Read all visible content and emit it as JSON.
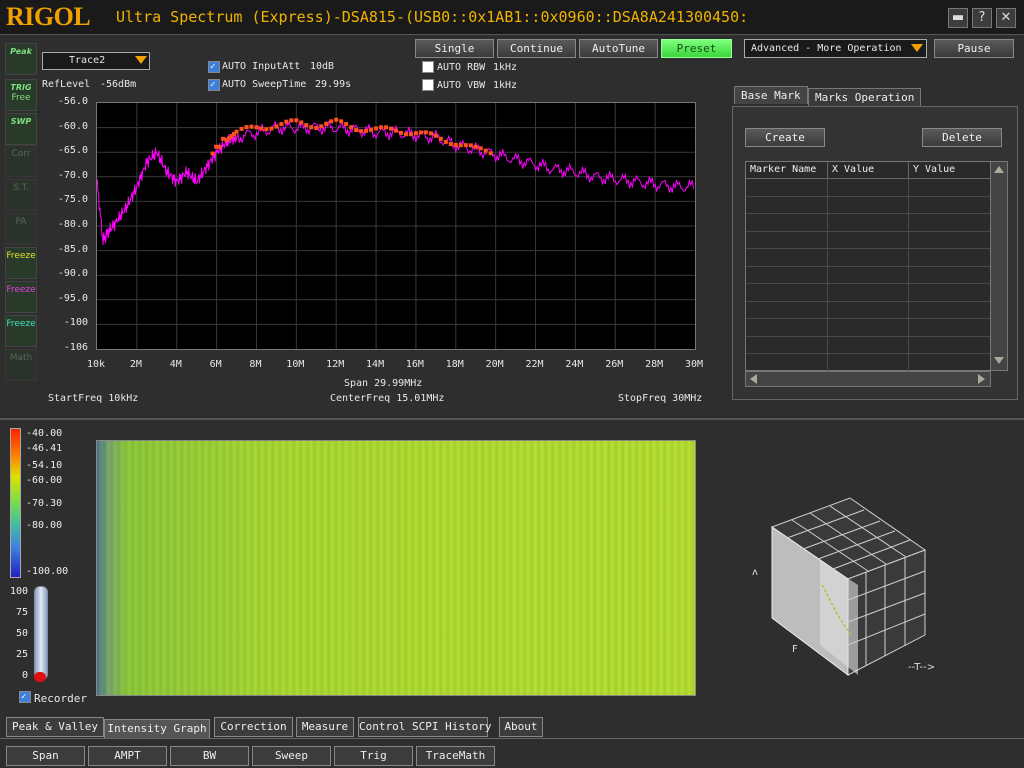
{
  "app": {
    "logo": "RIGOL",
    "title": "Ultra Spectrum (Express)-DSA815-(USB0::0x1AB1::0x0960::DSA8A241300450:",
    "window_controls": {
      "minimize": "▬",
      "help": "?",
      "close": "✕"
    }
  },
  "toolbar": {
    "single": "Single",
    "continue": "Continue",
    "autotune": "AutoTune",
    "preset": "Preset",
    "advanced": "Advanced - More Operation",
    "pause": "Pause"
  },
  "trace_select": "Trace2",
  "reflevel": {
    "label": "RefLevel",
    "value": "-56dBm"
  },
  "settings": {
    "auto_inputatt": {
      "label": "AUTO InputAtt",
      "value": "10dB",
      "checked": true
    },
    "auto_sweeptime": {
      "label": "AUTO SweepTime",
      "value": "29.99s",
      "checked": true
    },
    "auto_rbw": {
      "label": "AUTO RBW",
      "value": "1kHz",
      "checked": false
    },
    "auto_vbw": {
      "label": "AUTO VBW",
      "value": "1kHz",
      "checked": false
    }
  },
  "side_tools": [
    {
      "top": "Peak",
      "bottom": "",
      "icon": "peak-icon"
    },
    {
      "top": "TRIG",
      "bottom": "Free",
      "icon": "trig-icon"
    },
    {
      "top": "SWP",
      "bottom": "",
      "icon": "sweep-icon"
    },
    {
      "top": "",
      "bottom": "Corr",
      "icon": "corr-icon"
    },
    {
      "top": "",
      "bottom": "S.T.",
      "icon": "st-icon"
    },
    {
      "top": "",
      "bottom": "PA",
      "icon": "pa-icon"
    },
    {
      "top": "",
      "bottom": "Freeze",
      "icon": "freeze-yellow-icon"
    },
    {
      "top": "",
      "bottom": "Freeze",
      "icon": "freeze-magenta-icon"
    },
    {
      "top": "",
      "bottom": "Freeze",
      "icon": "freeze-cyan-icon"
    },
    {
      "top": "",
      "bottom": "Math",
      "icon": "math-icon"
    }
  ],
  "spectrum": {
    "span": "Span  29.99MHz",
    "start": "StartFreq  10kHz",
    "center": "CenterFreq  15.01MHz",
    "stop": "StopFreq  30MHz"
  },
  "chart_data": {
    "type": "line",
    "x_ticks": [
      "10k",
      "2M",
      "4M",
      "6M",
      "8M",
      "10M",
      "12M",
      "14M",
      "16M",
      "18M",
      "20M",
      "22M",
      "24M",
      "26M",
      "28M",
      "30M"
    ],
    "y_ticks": [
      "-56.0",
      "-60.0",
      "-65.0",
      "-70.0",
      "-75.0",
      "-80.0",
      "-85.0",
      "-90.0",
      "-95.0",
      "-100",
      "-106"
    ],
    "xlim": [
      0,
      30
    ],
    "ylim": [
      -106,
      -56
    ],
    "grid": true,
    "series": [
      {
        "color": "#ff00ff",
        "x": [
          0,
          0.3,
          0.6,
          1,
          1.5,
          2,
          2.5,
          3,
          3.5,
          4,
          4.5,
          5,
          5.5,
          6,
          6.5,
          7,
          8,
          9,
          10,
          11,
          12,
          13,
          14,
          15,
          16,
          17,
          18,
          19,
          20,
          21,
          22,
          23,
          24,
          25,
          26,
          27,
          28,
          29,
          30
        ],
        "y": [
          -72,
          -84,
          -82,
          -80,
          -77,
          -73,
          -68,
          -66,
          -70,
          -72,
          -70,
          -72,
          -69,
          -66,
          -64,
          -63,
          -62,
          -61,
          -61,
          -61,
          -61,
          -61.5,
          -62,
          -62,
          -62.5,
          -63,
          -64.5,
          -65.5,
          -66.5,
          -67.5,
          -68.5,
          -69.5,
          -70,
          -71,
          -71.5,
          -72,
          -72.5,
          -73,
          -73
        ]
      },
      {
        "color": "#ff5020",
        "x": [
          5.8,
          6.5,
          7,
          8,
          9,
          10,
          11,
          12,
          13,
          14,
          15,
          16,
          17,
          18,
          19,
          20
        ],
        "y": [
          -66,
          -63,
          -62,
          -61,
          -60.5,
          -60,
          -60.5,
          -60,
          -61,
          -61.5,
          -61.5,
          -62,
          -63,
          -64,
          -65.5,
          -66
        ]
      }
    ]
  },
  "marker_panel": {
    "tabs": [
      "Base Mark",
      "Marks Operation"
    ],
    "create": "Create",
    "delete": "Delete",
    "columns": [
      "Marker Name",
      "X Value",
      "Y Value"
    ]
  },
  "intensity": {
    "colorbar_labels": [
      "-40.00",
      "-46.41",
      "-54.10",
      "-60.00",
      "-70.30",
      "-80.00",
      "-100.00"
    ],
    "thermo_labels": [
      "100",
      "75",
      "50",
      "25",
      "0"
    ],
    "recorder": "Recorder",
    "recorder_checked": true
  },
  "bottom_tabs": [
    "Peak & Valley",
    "Intensity Graph",
    "Correction",
    "Measure",
    "Control SCPI History",
    "About"
  ],
  "bottom_buttons": [
    "Span",
    "AMPT",
    "BW",
    "Sweep",
    "Trig",
    "TraceMath"
  ]
}
